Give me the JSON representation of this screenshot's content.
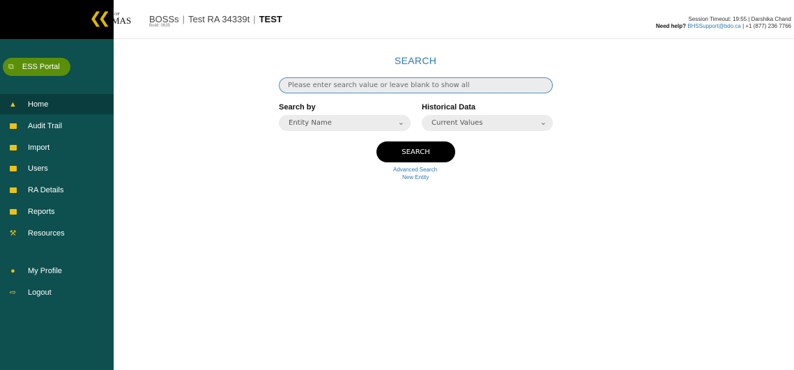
{
  "header": {
    "collapse_icon": "double-chevron-left-icon",
    "logo_small": "OF",
    "logo_text": "MAS",
    "app_name": "BOSSs",
    "ra_name": "Test RA 34339t",
    "environment": "TEST",
    "build": "Build: 0635",
    "session": "Session Timeout: 19:55 | Darshika Chand",
    "help_label": "Need help?",
    "help_email": "BHSSupport@bdo.ca",
    "help_phone": "| +1 (877) 236 7766"
  },
  "sidebar": {
    "ess_portal": {
      "label": "ESS Portal",
      "icon": "external-link-icon"
    },
    "items": [
      {
        "label": "Home",
        "icon": "home-icon"
      },
      {
        "label": "Audit Trail",
        "icon": "audit-trail-icon"
      },
      {
        "label": "Import",
        "icon": "import-icon"
      },
      {
        "label": "Users",
        "icon": "users-icon"
      },
      {
        "label": "RA Details",
        "icon": "ra-details-icon"
      },
      {
        "label": "Reports",
        "icon": "reports-icon"
      },
      {
        "label": "Resources",
        "icon": "tools-icon"
      },
      {
        "label": "My Profile",
        "icon": "profile-icon"
      },
      {
        "label": "Logout",
        "icon": "logout-icon"
      }
    ]
  },
  "main": {
    "title": "SEARCH",
    "search_placeholder": "Please enter search value or leave blank to show all",
    "search_by_label": "Search by",
    "search_by_value": "Entity Name",
    "historical_label": "Historical Data",
    "historical_value": "Current Values",
    "search_button": "SEARCH",
    "advanced_search": "Advanced Search",
    "new_entity": "New Entity"
  },
  "colors": {
    "sidebar_bg": "#0e4f4f",
    "ess_portal_bg": "#5b8f0a",
    "accent_yellow": "#e8c21a",
    "link_blue": "#2a7ab8"
  }
}
